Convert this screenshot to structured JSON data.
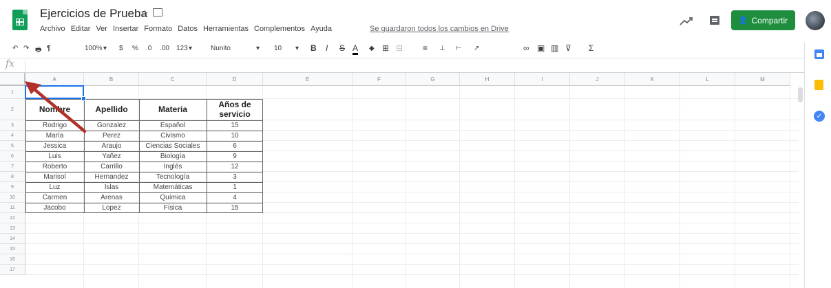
{
  "app": {
    "doc_title": "Ejercicios de Prueba",
    "save_status": "Se guardaron todos los cambios en Drive",
    "share_label": "Compartir",
    "star_glyph": "☆",
    "person_glyph": "👤"
  },
  "menu": [
    "Archivo",
    "Editar",
    "Ver",
    "Insertar",
    "Formato",
    "Datos",
    "Herramientas",
    "Complementos",
    "Ayuda"
  ],
  "toolbar": {
    "undo": "↶",
    "redo": "↷",
    "print": "🖶",
    "paint_format": "¶",
    "zoom": "100%",
    "zoom_caret": "▾",
    "currency": "$",
    "percent": "%",
    "dec_less": ".0",
    "dec_more": ".00",
    "more_formats": "123",
    "font": "Nunito",
    "font_caret": "▾",
    "font_size": "10",
    "size_caret": "▾",
    "bold": "B",
    "italic": "I",
    "strike": "S",
    "text_color": "A",
    "fill_color": "◆",
    "borders": "⊞",
    "merge": "⊟",
    "h_align": "≡",
    "v_align": "⊥",
    "wrap": "⊢",
    "rotate": "↗",
    "link": "∞",
    "comment": "▣",
    "chart": "▥",
    "filter": "⊽",
    "functions": "Σ",
    "collapse": "^"
  },
  "formula": {
    "fx_label": "fx"
  },
  "columns": [
    "A",
    "B",
    "C",
    "D",
    "E",
    "F",
    "G",
    "H",
    "I",
    "J",
    "K",
    "L",
    "M"
  ],
  "rows": [
    "1",
    "2",
    "3",
    "4",
    "5",
    "6",
    "7",
    "8",
    "9",
    "10",
    "11",
    "12",
    "13",
    "14",
    "15",
    "16",
    "17"
  ],
  "table": {
    "headers": [
      "Nombre",
      "Apellido",
      "Materia",
      "Años de servicio"
    ],
    "records": [
      [
        "Rodrigo",
        "Gonzalez",
        "Español",
        "15"
      ],
      [
        "María",
        "Perez",
        "Civismo",
        "10"
      ],
      [
        "Jessica",
        "Araujo",
        "Ciencias Sociales",
        "6"
      ],
      [
        "Luis",
        "Yañez",
        "Biología",
        "9"
      ],
      [
        "Roberto",
        "Carrillo",
        "Inglés",
        "12"
      ],
      [
        "Marisol",
        "Hernandez",
        "Tecnología",
        "3"
      ],
      [
        "Luz",
        "Islas",
        "Matemáticas",
        "1"
      ],
      [
        "Carmen",
        "Arenas",
        "Química",
        "4"
      ],
      [
        "Jacobo",
        "Lopez",
        "Física",
        "15"
      ]
    ]
  },
  "selected_cell": "A1",
  "accent_colors": {
    "share": "#1e8e3e",
    "selection": "#1a73e8",
    "annotation_arrow": "#b1302a"
  }
}
